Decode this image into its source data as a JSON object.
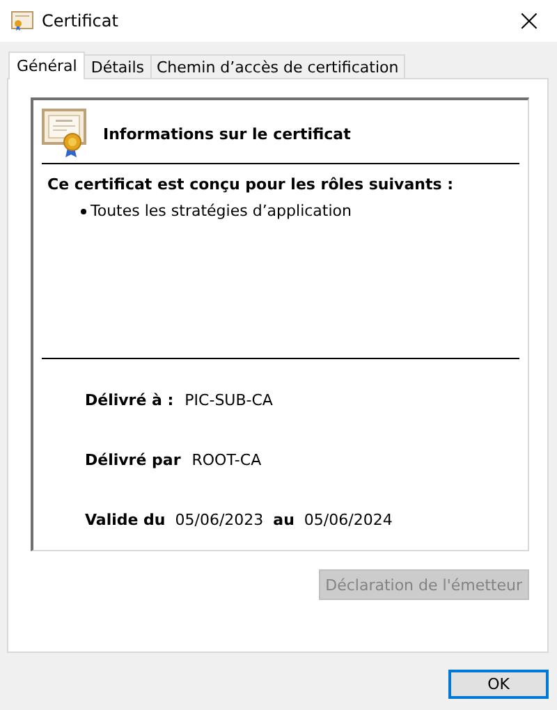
{
  "window": {
    "title": "Certificat",
    "close": "×"
  },
  "tabs": [
    {
      "label": "Général",
      "selected": true
    },
    {
      "label": "Détails",
      "selected": false
    },
    {
      "label": "Chemin d’accès de certification",
      "selected": false
    }
  ],
  "header": "Informations sur le certificat",
  "purpose_title": "Ce certificat est conçu pour les rôles suivants :",
  "purposes": [
    "Toutes les stratégies d’application"
  ],
  "issued_to": {
    "label": "Délivré à :",
    "value": "PIC-SUB-CA"
  },
  "issued_by": {
    "label": "Délivré par",
    "value": "ROOT-CA"
  },
  "validity": {
    "label": "Valide du",
    "from": "05/06/2023",
    "to_label": "au",
    "to": "05/06/2024"
  },
  "statement_button": {
    "label": "Déclaration de l'émetteur",
    "disabled": true
  },
  "ok_button": {
    "label": "OK"
  }
}
